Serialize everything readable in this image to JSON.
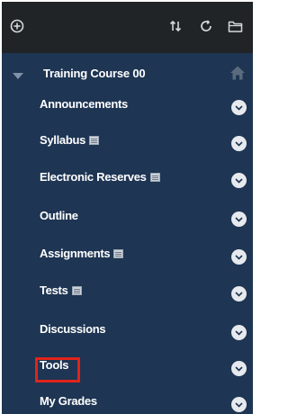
{
  "toolbar": {
    "icons": [
      "add-circle-icon",
      "reorder-arrows-icon",
      "refresh-icon",
      "folder-icon"
    ]
  },
  "course": {
    "title": "Training Course 00"
  },
  "menu": {
    "items": [
      {
        "label": "Announcements",
        "hidden_badge": false
      },
      {
        "label": "Syllabus",
        "hidden_badge": true
      },
      {
        "label": "Electronic Reserves",
        "hidden_badge": true
      },
      {
        "label": "Outline",
        "hidden_badge": false
      },
      {
        "label": "Assignments",
        "hidden_badge": true
      },
      {
        "label": "Tests",
        "hidden_badge": true
      },
      {
        "label": "Discussions",
        "hidden_badge": false
      },
      {
        "label": "Tools",
        "hidden_badge": false,
        "highlighted": true
      },
      {
        "label": "My Grades",
        "hidden_badge": false
      }
    ]
  },
  "colors": {
    "panel_background": "#1e3553",
    "toolbar_background": "#202427",
    "highlight": "#e0241b"
  }
}
